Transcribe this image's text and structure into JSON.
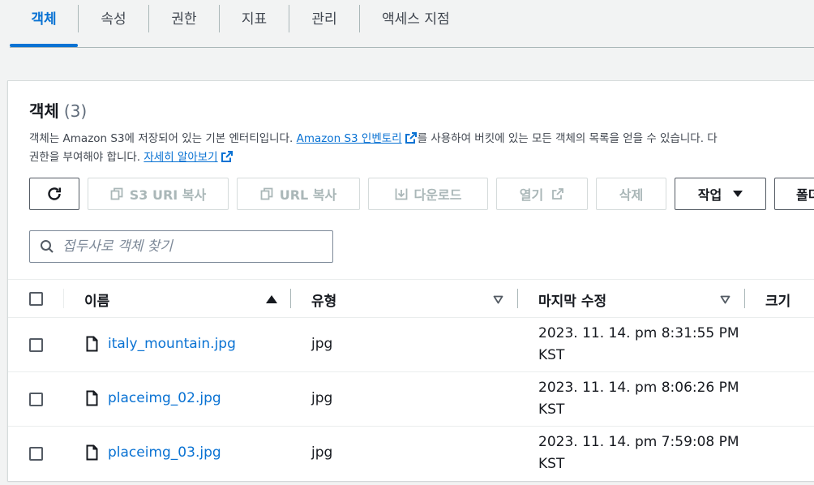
{
  "tabs": [
    {
      "label": "객체",
      "active": true
    },
    {
      "label": "속성"
    },
    {
      "label": "권한"
    },
    {
      "label": "지표"
    },
    {
      "label": "관리"
    },
    {
      "label": "액세스 지점"
    }
  ],
  "panel": {
    "title": "객체",
    "count": "(3)",
    "desc_line1_a": "객체는 Amazon S3에 저장되어 있는 기본 엔터티입니다. ",
    "desc_link1": "Amazon S3 인벤토리",
    "desc_line1_b": "를 사용하여 버킷에 있는 모든 객체의 목록을 얻을 수 있습니다. 다",
    "desc_line2_a": "권한을 부여해야 합니다. ",
    "desc_link2": "자세히 알아보기"
  },
  "toolbar": {
    "refresh_label": "",
    "copy_s3_uri": "S3 URI 복사",
    "copy_url": "URL 복사",
    "download": "다운로드",
    "open": "열기",
    "delete": "삭제",
    "actions": "작업",
    "create_folder": "폴더"
  },
  "search": {
    "placeholder": "접두사로 객체 찾기",
    "value": ""
  },
  "table": {
    "columns": [
      "이름",
      "유형",
      "마지막 수정",
      "크기"
    ],
    "rows": [
      {
        "name": "italy_mountain.jpg",
        "type": "jpg",
        "modified_1": "2023. 11. 14. pm 8:31:55 PM",
        "modified_2": "KST"
      },
      {
        "name": "placeimg_02.jpg",
        "type": "jpg",
        "modified_1": "2023. 11. 14. pm 8:06:26 PM",
        "modified_2": "KST"
      },
      {
        "name": "placeimg_03.jpg",
        "type": "jpg",
        "modified_1": "2023. 11. 14. pm 7:59:08 PM",
        "modified_2": "KST"
      }
    ]
  },
  "colors": {
    "accent": "#0972d3",
    "text": "#16191f",
    "disabled": "#aab7b8"
  }
}
